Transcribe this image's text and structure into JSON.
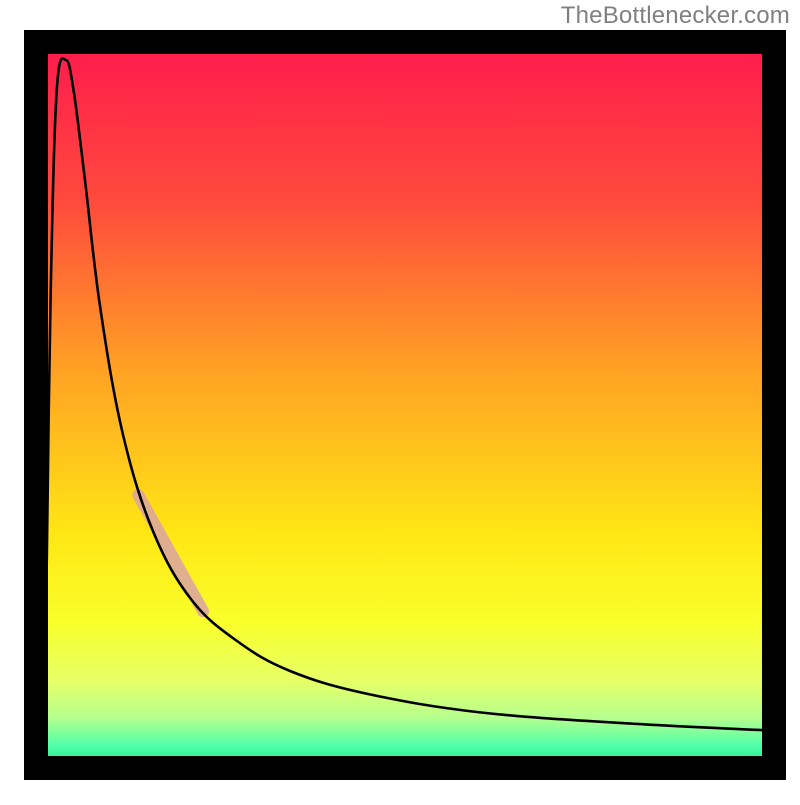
{
  "watermark": "TheBottlenecker.com",
  "chart_data": {
    "type": "line",
    "title": "",
    "xlabel": "",
    "ylabel": "",
    "xlim": [
      0,
      100
    ],
    "ylim": [
      0,
      100
    ],
    "background_gradient_stops": [
      {
        "t": 0.0,
        "color": "#ff1a4d"
      },
      {
        "t": 0.22,
        "color": "#ff4a3d"
      },
      {
        "t": 0.45,
        "color": "#ffa124"
      },
      {
        "t": 0.68,
        "color": "#ffe714"
      },
      {
        "t": 0.8,
        "color": "#f9ff2b"
      },
      {
        "t": 0.88,
        "color": "#e6ff66"
      },
      {
        "t": 0.93,
        "color": "#b7ff8e"
      },
      {
        "t": 0.97,
        "color": "#4fffa8"
      },
      {
        "t": 1.0,
        "color": "#16e08a"
      }
    ],
    "series": [
      {
        "name": "bottleneck-curve",
        "stroke": "#000000",
        "stroke_width": 2.6,
        "points": [
          {
            "x": 2.6,
            "y": 6.0
          },
          {
            "x": 3.0,
            "y": 30.0
          },
          {
            "x": 3.5,
            "y": 65.0
          },
          {
            "x": 4.3,
            "y": 92.0
          },
          {
            "x": 5.5,
            "y": 96.0
          },
          {
            "x": 6.5,
            "y": 92.0
          },
          {
            "x": 8.0,
            "y": 80.0
          },
          {
            "x": 10.0,
            "y": 63.0
          },
          {
            "x": 13.0,
            "y": 46.0
          },
          {
            "x": 17.0,
            "y": 33.0
          },
          {
            "x": 22.0,
            "y": 24.0
          },
          {
            "x": 28.0,
            "y": 18.5
          },
          {
            "x": 35.0,
            "y": 14.5
          },
          {
            "x": 45.0,
            "y": 11.5
          },
          {
            "x": 60.0,
            "y": 9.0
          },
          {
            "x": 80.0,
            "y": 7.5
          },
          {
            "x": 100.0,
            "y": 6.5
          }
        ]
      },
      {
        "name": "highlight-segment",
        "stroke": "#d9a3a3",
        "stroke_width": 12,
        "stroke_opacity": 0.85,
        "linecap": "round",
        "points": [
          {
            "x": 15.0,
            "y": 38.0
          },
          {
            "x": 23.5,
            "y": 22.5
          }
        ]
      }
    ],
    "frame": {
      "inset_left": 24,
      "inset_top": 30,
      "inset_right": 14,
      "inset_bottom": 20,
      "stroke": "#000000",
      "stroke_width": 24
    }
  }
}
